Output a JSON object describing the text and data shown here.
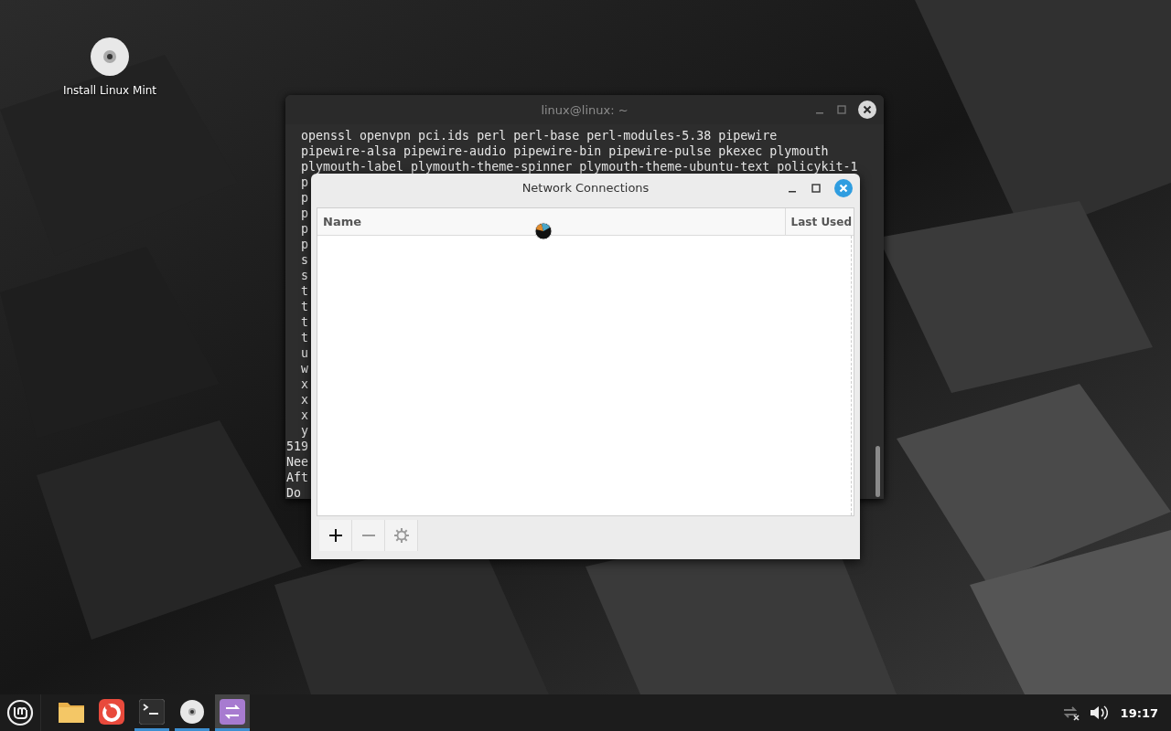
{
  "desktop_icons": [
    {
      "label": "Install Linux Mint"
    }
  ],
  "terminal": {
    "title": "linux@linux: ~",
    "lines": [
      {
        "kind": "package",
        "text": "openssl openvpn pci.ids perl perl-base perl-modules-5.38 pipewire"
      },
      {
        "kind": "package",
        "text": "pipewire-alsa pipewire-audio pipewire-bin pipewire-pulse pkexec plymouth"
      },
      {
        "kind": "package",
        "text": "plymouth-label plymouth-theme-spinner plymouth-theme-ubuntu-text policykit-1"
      },
      {
        "kind": "package",
        "text": "p"
      },
      {
        "kind": "package",
        "text": "p"
      },
      {
        "kind": "package",
        "text": "p"
      },
      {
        "kind": "package",
        "text": "p"
      },
      {
        "kind": "package",
        "text": "p"
      },
      {
        "kind": "package",
        "text": "s"
      },
      {
        "kind": "package",
        "text": "s"
      },
      {
        "kind": "package",
        "text": "t"
      },
      {
        "kind": "package",
        "text": "t"
      },
      {
        "kind": "package",
        "text": "t"
      },
      {
        "kind": "package",
        "text": "t"
      },
      {
        "kind": "package",
        "text": "u"
      },
      {
        "kind": "package",
        "text": "w"
      },
      {
        "kind": "package",
        "text": "x"
      },
      {
        "kind": "package",
        "text": "x"
      },
      {
        "kind": "package",
        "text": "x"
      },
      {
        "kind": "package",
        "text": "y"
      },
      {
        "kind": "output",
        "text": "519"
      },
      {
        "kind": "output",
        "text": "Nee"
      },
      {
        "kind": "output",
        "text": "Aft"
      },
      {
        "kind": "output",
        "text": "Do"
      }
    ]
  },
  "dialog": {
    "title": "Network Connections",
    "columns": [
      "Name",
      "Last Used"
    ],
    "toolbar": [
      {
        "kind": "add",
        "disabled": false
      },
      {
        "kind": "remove",
        "disabled": true
      },
      {
        "kind": "settings",
        "disabled": true
      }
    ]
  },
  "taskbar": {
    "apps": [
      {
        "kind": "files",
        "running": false,
        "selected": false
      },
      {
        "kind": "browser",
        "running": false,
        "selected": false
      },
      {
        "kind": "terminal",
        "running": true,
        "selected": false
      },
      {
        "kind": "disc",
        "running": true,
        "selected": false
      },
      {
        "kind": "network",
        "running": true,
        "selected": true
      }
    ],
    "clock": "19:17"
  }
}
